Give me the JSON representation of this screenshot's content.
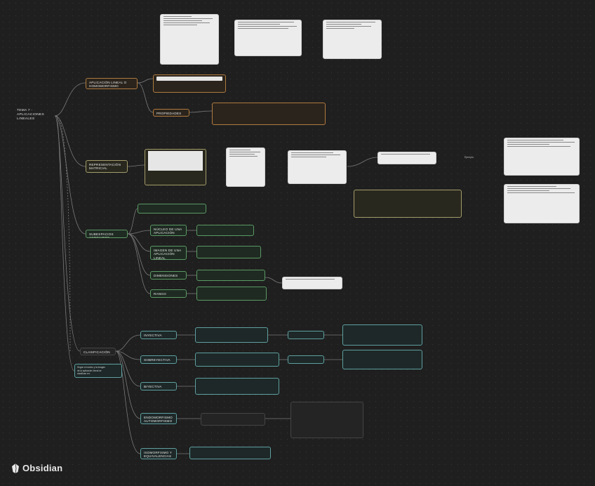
{
  "brand": {
    "name": "Obsidian",
    "icon": "obsidian-gem-icon"
  },
  "root": {
    "title": "TEMA 7 -\nAPLICACIONES\nLINEALES"
  },
  "nodes": {
    "def": "APLICACIÓN LINEAL O\nHOMOMORFISMO",
    "propiedades": "PROPIEDADES",
    "representacion": "REPRESENTACIÓN\nMATRICIAL",
    "subespacios": "SUBESPACIOS ASOCIADOS",
    "nucleo": "NÚCLEO DE UNA\nAPLICACIÓN LINEAL",
    "imagen": "IMAGEN DE UNA\nAPLICACIÓN\nLINEAL",
    "dimensiones": "DIMENSIONES",
    "rango": "RANGO",
    "clasificacion": "CLASIFICACIÓN",
    "inyectiva": "INYECTIVA",
    "sobreyectiva": "SOBREYECTIVA",
    "biyectiva": "BIYECTIVA",
    "endomorfismo": "ENDOMORFISMO\nAUTOMORFISMO",
    "isomorfismo": "ISOMORFISMO Y\nEQUIVALENCIAS",
    "clasif_note": "Según el núcleo y la imagen\nde la aplicación lineal se\nclasifican en:",
    "left_label": "Ejemplo"
  }
}
